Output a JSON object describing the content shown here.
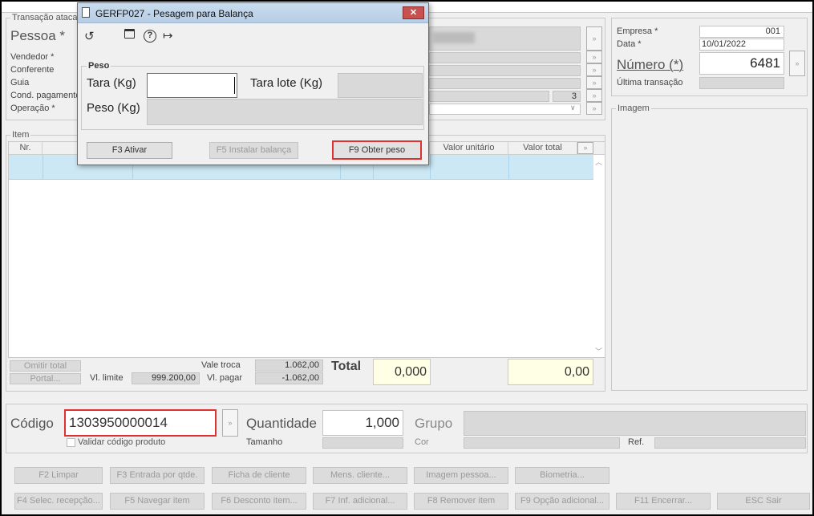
{
  "main": {
    "transacao_group": "Transação atacado",
    "pessoa_label": "Pessoa *",
    "vendedor_label": "Vendedor *",
    "conferente_label": "Conferente",
    "guia_label": "Guia",
    "cond_pagamento_label": "Cond. pagamento",
    "operacao_label": "Operação *",
    "cond_value": "3",
    "empresa_label": "Empresa *",
    "empresa_value": "001",
    "data_label": "Data *",
    "data_value": "10/01/2022",
    "numero_label": "Número (*)",
    "numero_value": "6481",
    "ultima_label": "Última transação",
    "imagem_group": "Imagem",
    "item_group": "Item",
    "col_nr": "Nr.",
    "col_valor_unitario": "Valor unitário",
    "col_valor_total": "Valor total",
    "omitir_total": "Omitir total",
    "portal": "Portal...",
    "vl_limite_label": "Vl. limite",
    "vl_limite_value": "999.200,00",
    "vale_troca_label": "Vale troca",
    "vale_troca_value": "1.062,00",
    "vl_pagar_label": "Vl. pagar",
    "vl_pagar_value": "-1.062,00",
    "total_label": "Total",
    "total_qty": "0,000",
    "total_value": "0,00",
    "codigo_label": "Código",
    "codigo_value": "1303950000014",
    "validar_label": "Validar código produto",
    "quantidade_label": "Quantidade",
    "quantidade_value": "1,000",
    "tamanho_label": "Tamanho",
    "grupo_label": "Grupo",
    "cor_label": "Cor",
    "ref_label": "Ref."
  },
  "buttons_row1": [
    "F2 Limpar",
    "F3 Entrada por qtde.",
    "Ficha de cliente",
    "Mens. cliente...",
    "Imagem pessoa...",
    "Biometria..."
  ],
  "buttons_row2": [
    "F4 Selec. recepção...",
    "F5 Navegar item",
    "F6 Desconto item...",
    "F7 Inf. adicional...",
    "F8 Remover item",
    "F9 Opção adicional...",
    "F11 Encerrar...",
    "ESC Sair"
  ],
  "dialog": {
    "title": "GERFP027 - Pesagem para Balança",
    "peso_group": "Peso",
    "tara_label": "Tara (Kg)",
    "tara_value": "",
    "tara_lote_label": "Tara lote (Kg)",
    "peso_label": "Peso (Kg)",
    "btn_ativar": "F3 Ativar",
    "btn_instalar": "F5 Instalar balança",
    "btn_obter": "F9 Obter peso",
    "close": "✕"
  },
  "icons": {
    "doc": "document-icon",
    "refresh": "refresh-icon",
    "calendar": "calendar-icon",
    "help": "help-icon",
    "exit": "exit-icon"
  },
  "colors": {
    "highlight_row": "#cce8f4",
    "total_bg": "#ffffe6",
    "red_focus": "#e03131"
  }
}
